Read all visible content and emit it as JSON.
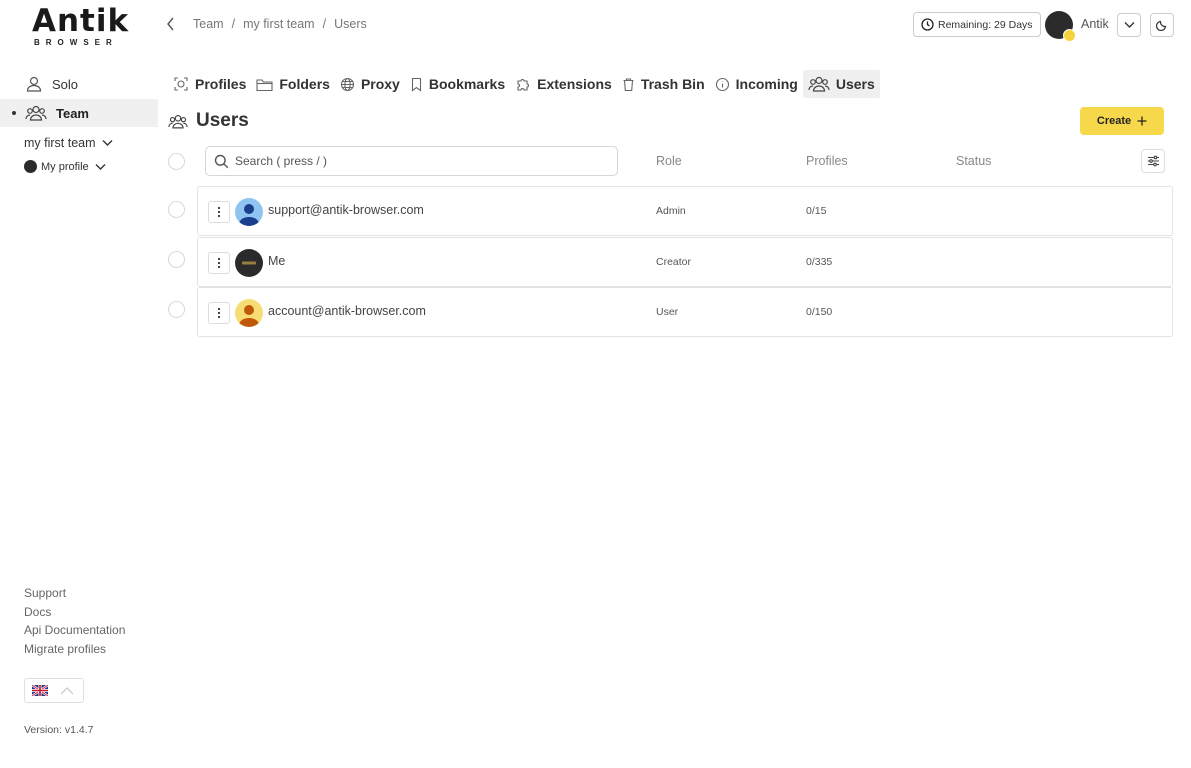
{
  "brand": {
    "name": "Antik",
    "sub": "BROWSER"
  },
  "sidebar": {
    "items": [
      {
        "label": "Solo"
      },
      {
        "label": "Team"
      }
    ],
    "team_select": "my first team",
    "profile_select": "My profile",
    "links": [
      "Support",
      "Docs",
      "Api Documentation",
      "Migrate profiles"
    ],
    "version": "Version: v1.4.7"
  },
  "breadcrumb": [
    "Team",
    "/",
    "my first team",
    "/",
    "Users"
  ],
  "header": {
    "remaining": "Remaining: 29 Days",
    "user_name": "Antik"
  },
  "tabs": [
    {
      "label": "Profiles"
    },
    {
      "label": "Folders"
    },
    {
      "label": "Proxy"
    },
    {
      "label": "Bookmarks"
    },
    {
      "label": "Extensions"
    },
    {
      "label": "Trash Bin"
    },
    {
      "label": "Incoming"
    },
    {
      "label": "Users"
    }
  ],
  "page": {
    "title": "Users",
    "create_label": "Create",
    "search_placeholder": "Search ( press / )",
    "columns": {
      "role": "Role",
      "profiles": "Profiles",
      "status": "Status"
    }
  },
  "users": [
    {
      "email": "support@antik-browser.com",
      "role": "Admin",
      "profiles": "0/15",
      "status": ""
    },
    {
      "email": "Me",
      "role": "Creator",
      "profiles": "0/335",
      "status": ""
    },
    {
      "email": "account@antik-browser.com",
      "role": "User",
      "profiles": "0/150",
      "status": ""
    }
  ],
  "colors": {
    "accent": "#f7d84a",
    "active_bg": "#f0f0f0",
    "border": "#e3e3e3"
  }
}
